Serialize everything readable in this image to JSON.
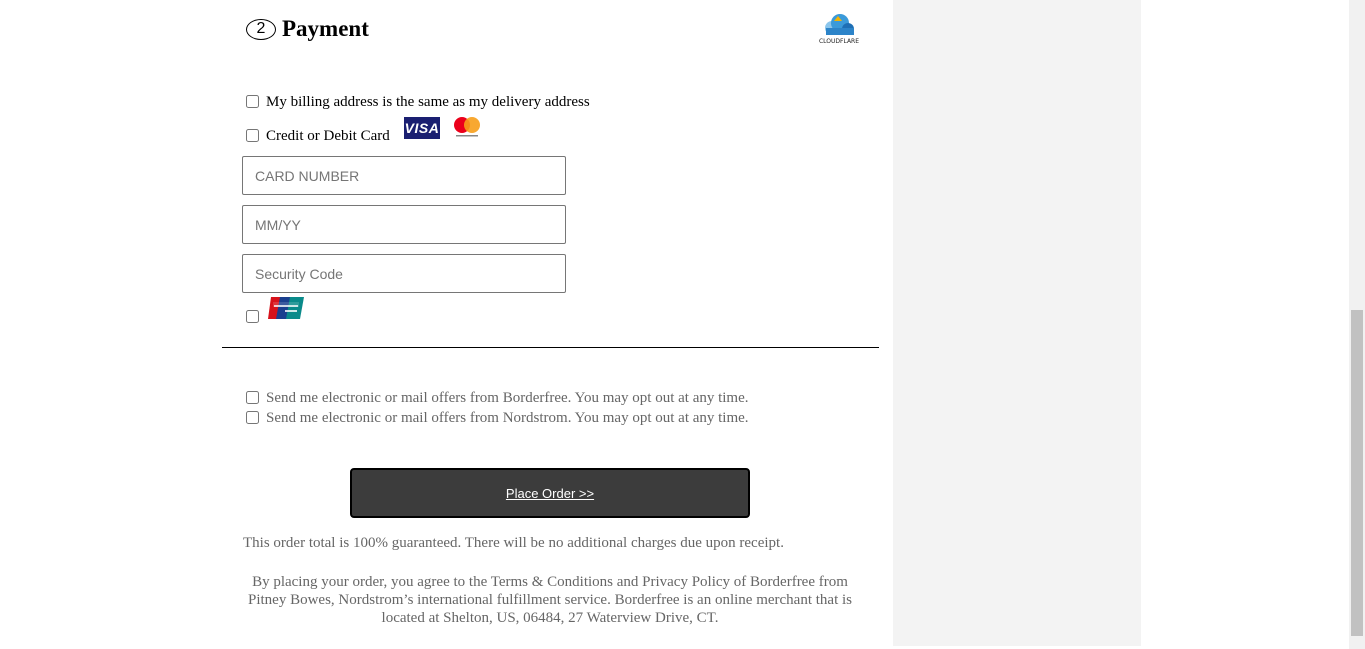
{
  "payment": {
    "step_number": "2",
    "title": "Payment"
  },
  "billing_same": {
    "label": "My billing address is the same as my delivery address",
    "checked": false
  },
  "credit_card": {
    "label": "Credit or Debit Card",
    "checked": false,
    "visa_text": "VISA",
    "card_number_placeholder": "CARD NUMBER",
    "expiry_placeholder": "MM/YY",
    "security_placeholder": "Security Code"
  },
  "unionpay": {
    "checked": false
  },
  "offers": {
    "borderfree": "Send me electronic or mail offers from Borderfree. You may opt out at any time.",
    "nordstrom": "Send me electronic or mail offers from Nordstrom. You may opt out at any time."
  },
  "place_order_label": "Place Order >>",
  "guarantee_text": "This order total is 100% guaranteed. There will be no additional charges due upon receipt.",
  "terms_text": "By placing your order, you agree to the Terms & Conditions and Privacy Policy of Borderfree from Pitney Bowes, Nordstrom’s international fulfillment service. Borderfree is an online merchant that is located at Shelton, US, 06484, 27 Waterview Drive, CT.",
  "colors": {
    "button_bg": "#3c3c3c",
    "visa_blue": "#1a1f71",
    "mc_red": "#eb001b",
    "mc_orange": "#f79e1b"
  }
}
